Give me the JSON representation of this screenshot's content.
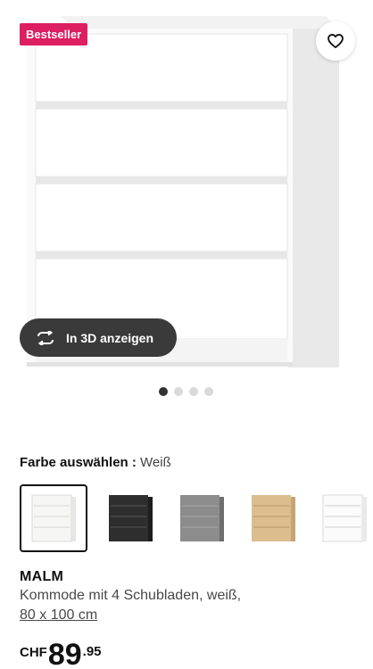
{
  "hero": {
    "badge": "Bestseller",
    "image": "malm-dresser-white",
    "favorite_icon": "heart-outline-icon",
    "view3d_label": "In 3D anzeigen",
    "view3d_icon": "rotate-arrows-icon",
    "carousel": {
      "count": 4,
      "active": 1
    }
  },
  "color": {
    "label": "Farbe auswählen :",
    "selected_value": "Weiß",
    "swatches": [
      {
        "name": "white",
        "color": "#f4f4f2",
        "selected": true
      },
      {
        "name": "black-brown",
        "color": "#2b2b2b",
        "selected": false
      },
      {
        "name": "grey",
        "color": "#8a8a8a",
        "selected": false
      },
      {
        "name": "oak-veneer",
        "color": "#d9b98a",
        "selected": false
      },
      {
        "name": "high-gloss-white",
        "color": "#f7f7f7",
        "selected": false
      }
    ]
  },
  "product": {
    "name": "MALM",
    "description": "Kommode mit 4 Schubladen, weiß,",
    "size": "80 x 100 cm"
  },
  "price": {
    "currency": "CHF",
    "integer": "89",
    "decimals": ".95"
  },
  "colors": {
    "badge": "#dd1e61",
    "button3d": "#3a3a3a"
  }
}
